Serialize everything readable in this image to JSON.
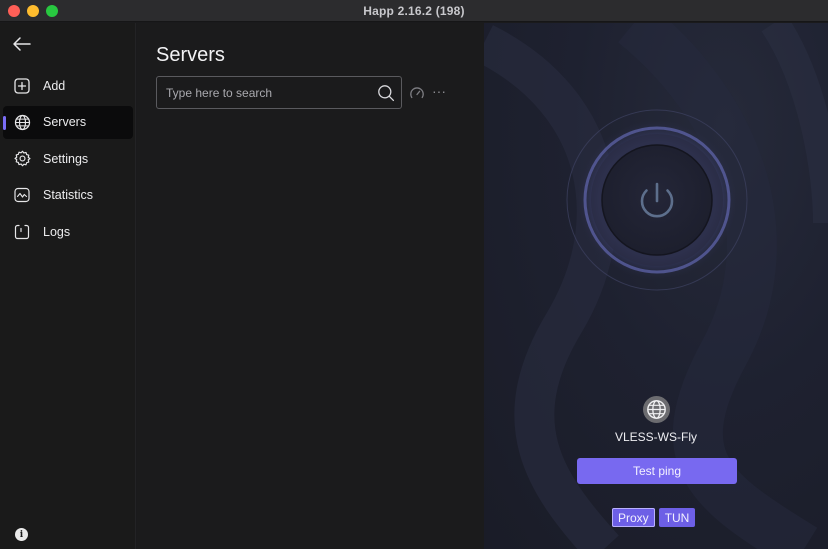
{
  "window": {
    "title": "Happ 2.16.2 (198)"
  },
  "sidebar": {
    "back_icon": "arrow-left-icon",
    "items": [
      {
        "label": "Add",
        "icon": "plus-square-icon"
      },
      {
        "label": "Servers",
        "icon": "globe-icon",
        "active": true
      },
      {
        "label": "Settings",
        "icon": "gear-icon"
      },
      {
        "label": "Statistics",
        "icon": "activity-chart-icon"
      },
      {
        "label": "Logs",
        "icon": "log-bracket-icon"
      }
    ],
    "info_label": "i"
  },
  "main": {
    "title": "Servers",
    "search": {
      "placeholder": "Type here to search",
      "value": ""
    },
    "more_label": "···"
  },
  "panel": {
    "server_name": "VLESS-WS-Fly",
    "test_ping_label": "Test ping",
    "modes": [
      {
        "label": "Proxy",
        "active": true
      },
      {
        "label": "TUN",
        "active": false
      }
    ]
  },
  "colors": {
    "accent": "#7869f0",
    "sidebar_bg": "#1a1a1a",
    "panel_bg": "#1e2130"
  }
}
